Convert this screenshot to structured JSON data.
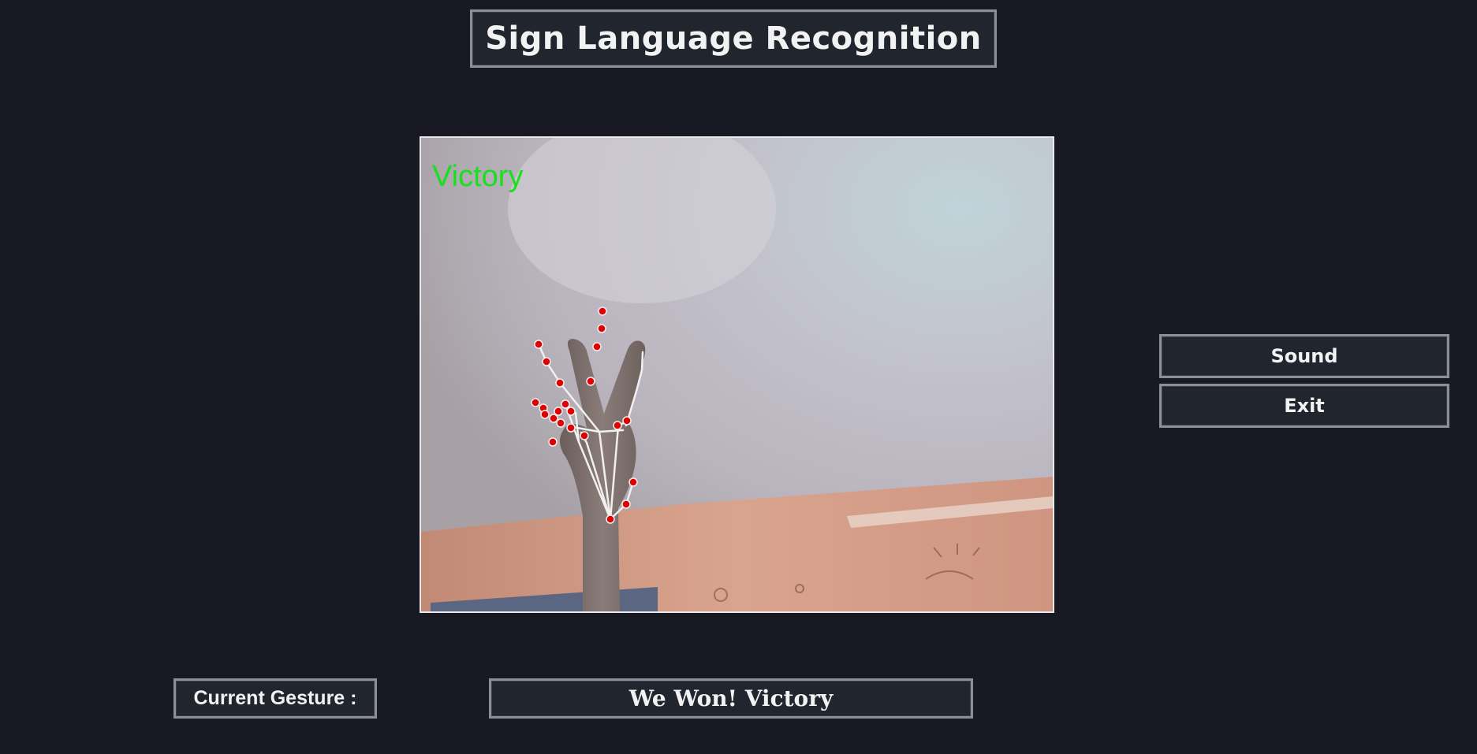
{
  "app": {
    "title": "Sign Language Recognition"
  },
  "camera": {
    "overlay_text": "Victory",
    "overlay_color": "#19e01c",
    "landmark_color": "#e00000",
    "connection_color": "#f0f0f0"
  },
  "buttons": {
    "sound_label": "Sound",
    "exit_label": "Exit"
  },
  "status": {
    "label": "Current Gesture :",
    "value": "We Won! Victory"
  }
}
